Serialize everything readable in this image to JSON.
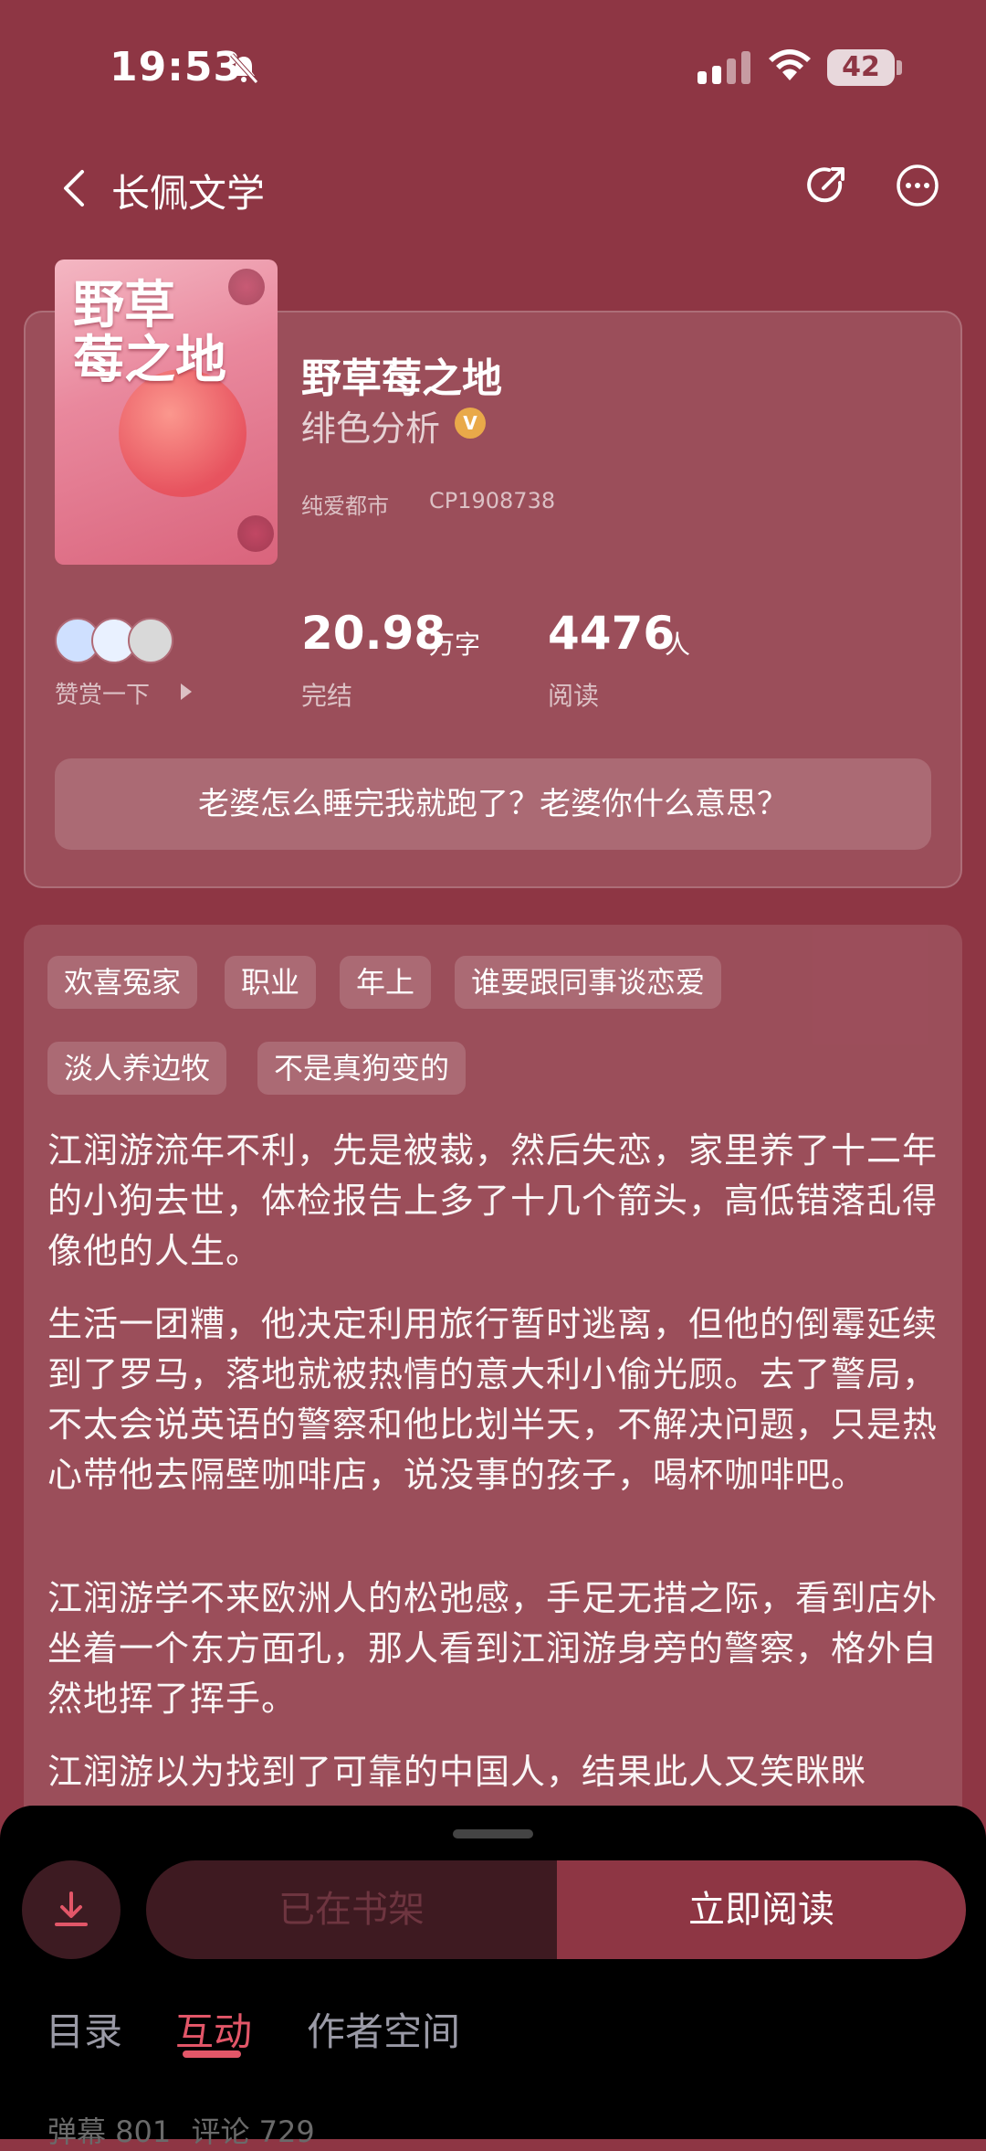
{
  "status": {
    "time": "19:53",
    "battery": "42"
  },
  "nav": {
    "title": "长佩文学"
  },
  "book": {
    "title": "野草莓之地",
    "author": "绯色分析",
    "category": "纯爱都市",
    "cp_id": "CP1908738",
    "cover_text": "野草莓之地"
  },
  "stats": {
    "reward_label": "赞赏一下",
    "words": "20.98",
    "words_unit": "万字",
    "words_status": "完结",
    "reads": "4476",
    "reads_unit": "人",
    "reads_label": "阅读"
  },
  "tagline": "老婆怎么睡完我就跑了？老婆你什么意思？",
  "tags": [
    "欢喜冤家",
    "职业",
    "年上",
    "谁要跟同事谈恋爱",
    "淡人养边牧",
    "不是真狗变的"
  ],
  "synopsis": [
    "江润游流年不利，先是被裁，然后失恋，家里养了十二年的小狗去世，体检报告上多了十几个箭头，高低错落乱得像他的人生。",
    "生活一团糟，他决定利用旅行暂时逃离，但他的倒霉延续到了罗马，落地就被热情的意大利小偷光顾。去了警局，不太会说英语的警察和他比划半天，不解决问题，只是热心带他去隔壁咖啡店，说没事的孩子，喝杯咖啡吧。",
    "江润游学不来欧洲人的松弛感，手足无措之际，看到店外坐着一个东方面孔，那人看到江润游身旁的警察，格外自然地挥了挥手。",
    "江润游以为找到了可靠的中国人，结果此人又笑眯眯"
  ],
  "actions": {
    "on_shelf": "已在书架",
    "read_now": "立即阅读"
  },
  "tabs": [
    "目录",
    "互动",
    "作者空间"
  ],
  "counts": {
    "danmaku": "弹幕 801",
    "comments": "评论 729"
  }
}
